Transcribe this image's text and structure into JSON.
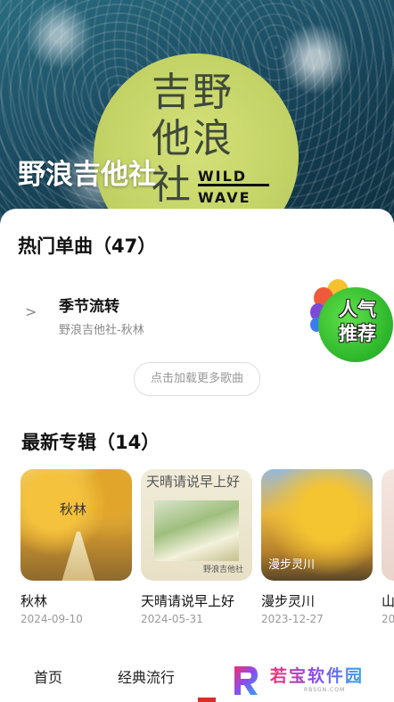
{
  "hero": {
    "title": "野浪吉他社",
    "cover_text": "吉野他浪社",
    "cover_wild": "WILD",
    "cover_wave": "WAVE"
  },
  "songs_section": {
    "title": "热门单曲（47）",
    "songs": [
      {
        "name": "季节流转",
        "sub": "野浪吉他社-秋林",
        "arrow": ">"
      }
    ],
    "load_more": "点击加载更多歌曲"
  },
  "badge": {
    "line1": "人气",
    "line2": "推荐"
  },
  "albums_section": {
    "title": "最新专辑（14）",
    "albums": [
      {
        "title": "秋林",
        "date": "2024-09-10",
        "cover_text": "秋林"
      },
      {
        "title": "天晴请说早上好",
        "date": "2024-05-31",
        "cover_text": "天晴请说早上好",
        "cover_small": "野浪吉他社"
      },
      {
        "title": "漫步灵川",
        "date": "2023-12-27",
        "cover_text": "漫步灵川"
      },
      {
        "title": "山",
        "date": "20"
      }
    ]
  },
  "bottom_nav": {
    "items": [
      "首页",
      "经典流行"
    ]
  },
  "watermark": {
    "text": "若宝软件园",
    "sub": "RBSGN.COM"
  }
}
